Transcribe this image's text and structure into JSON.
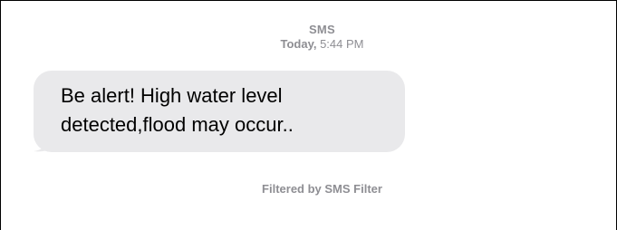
{
  "conversation": {
    "service": "SMS",
    "timestamp_day": "Today,",
    "timestamp_time": "5:44 PM"
  },
  "message": {
    "line1": "Be alert! High water level",
    "line2": "detected,flood may occur..",
    "bubble_color": "#e9e9eb"
  },
  "footer": {
    "filter_note": "Filtered by SMS Filter"
  },
  "colors": {
    "meta_text": "#8e8e93",
    "message_text": "#000000",
    "frame_border": "#000000"
  }
}
